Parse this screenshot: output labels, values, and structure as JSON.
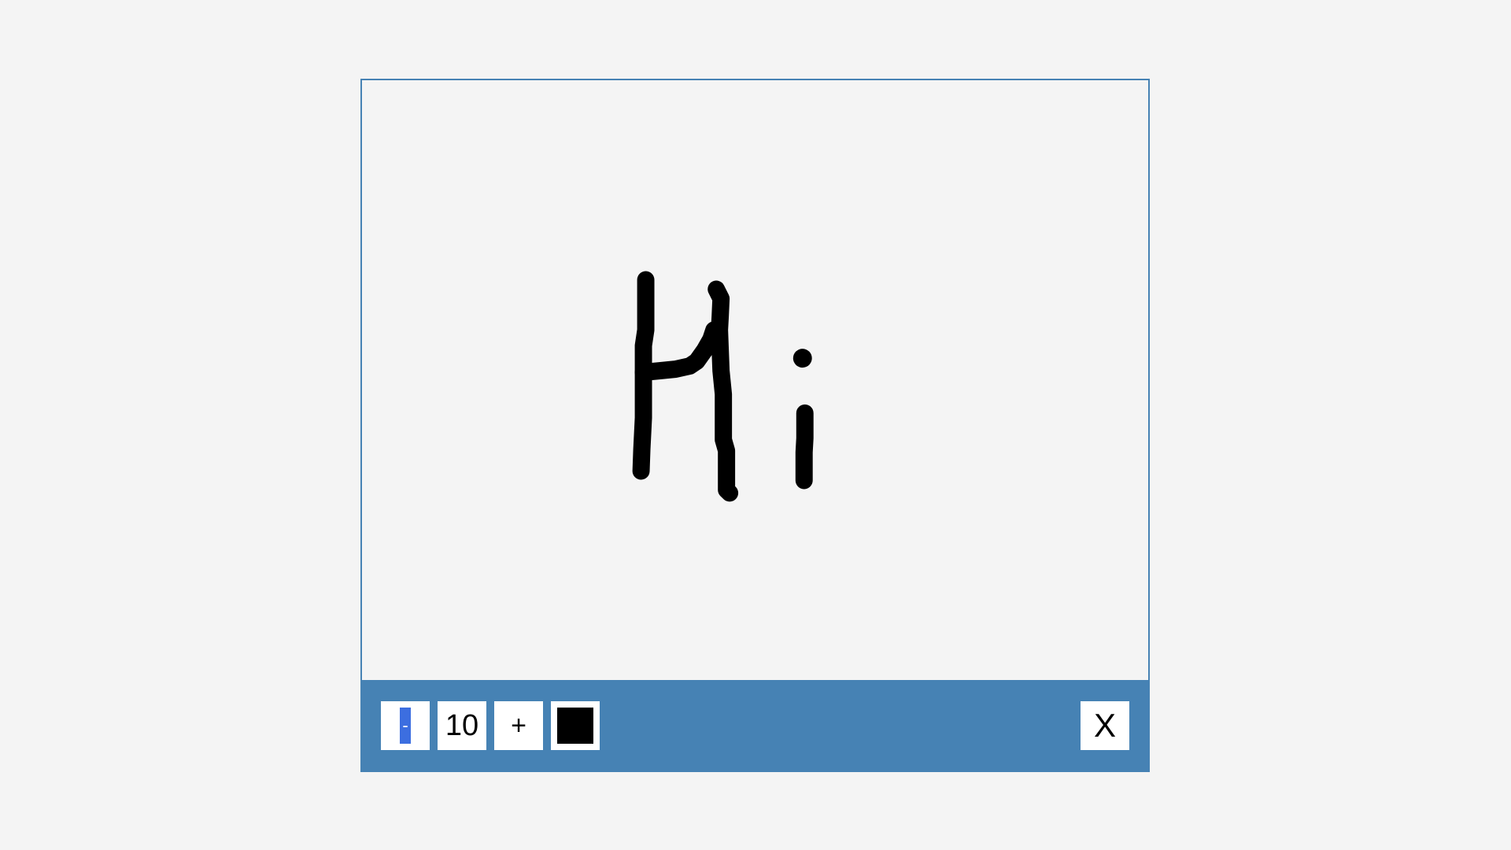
{
  "canvas": {
    "stroke_color": "#000000",
    "drawn_text": "Hi"
  },
  "toolbar": {
    "background": "#4682b4",
    "decrease_label": "-",
    "brush_size": "10",
    "increase_label": "+",
    "color_value": "#000000",
    "close_label": "X"
  },
  "icons": {
    "decrease": "minus-icon",
    "color": "color-swatch-icon",
    "close": "close-icon"
  }
}
